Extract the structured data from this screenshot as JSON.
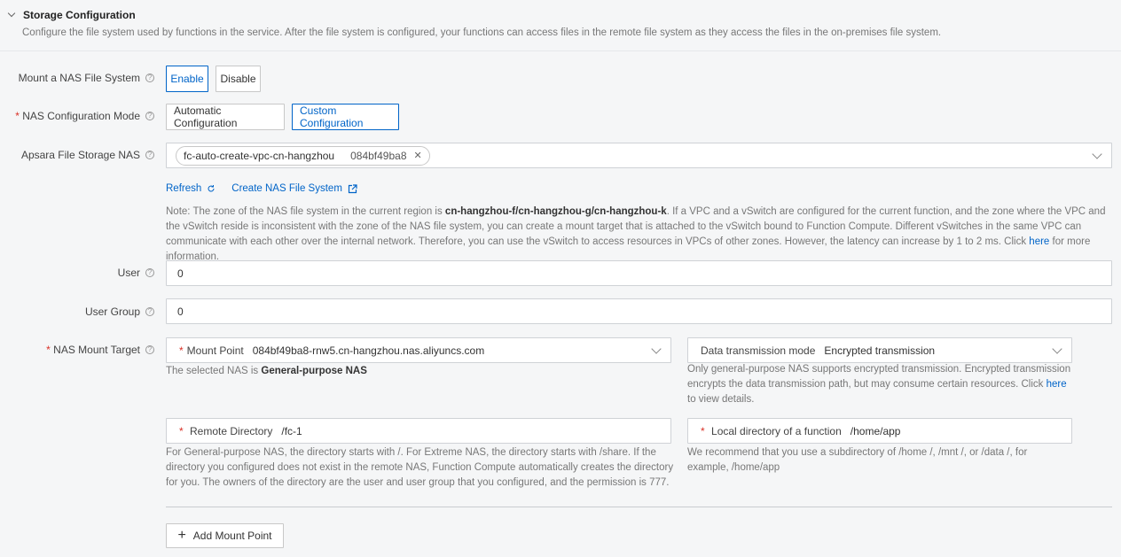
{
  "section": {
    "title": "Storage Configuration",
    "description": "Configure the file system used by functions in the service. After the file system is configured, your functions can access files in the remote file system as they access the files in the on-premises file system."
  },
  "mount_nas": {
    "label": "Mount a NAS File System",
    "options": [
      "Enable",
      "Disable"
    ],
    "selected": "Enable"
  },
  "config_mode": {
    "label": "NAS Configuration Mode",
    "required": "*",
    "options": [
      "Automatic Configuration",
      "Custom Configuration"
    ],
    "selected": "Custom Configuration"
  },
  "apsara_nas": {
    "label": "Apsara File Storage NAS",
    "tag_name": "fc-auto-create-vpc-cn-hangzhou",
    "tag_id": "084bf49ba8",
    "tag_close": "✕",
    "refresh_label": "Refresh",
    "create_label": "Create NAS File System",
    "note_prefix": "Note: The zone of the NAS file system in the current region is ",
    "note_zones": "cn-hangzhou-f/cn-hangzhou-g/cn-hangzhou-k",
    "note_body": ". If a VPC and a vSwitch are configured for the current function, and the zone where the VPC and the vSwitch reside is inconsistent with the zone of the NAS file system, you can create a mount target that is attached to the vSwitch bound to Function Compute. Different vSwitches in the same VPC can communicate with each other over the internal network. Therefore, you can use the vSwitch to access resources in VPCs of other zones. However, the latency can increase by 1 to 2 ms. Click ",
    "note_link": "here",
    "note_suffix": " for more information."
  },
  "user": {
    "label": "User",
    "value": "0"
  },
  "user_group": {
    "label": "User Group",
    "value": "0"
  },
  "mount_target": {
    "label": "NAS Mount Target",
    "required": "*",
    "mount_point_label": "Mount Point",
    "mount_point_value": "084bf49ba8-rnw5.cn-hangzhou.nas.aliyuncs.com",
    "selected_nas_prefix": "The selected NAS is ",
    "selected_nas_type": "General-purpose NAS",
    "transmission_label": "Data transmission mode",
    "transmission_value": "Encrypted transmission",
    "transmission_help_prefix": "Only general-purpose NAS supports encrypted transmission. Encrypted transmission encrypts the data transmission path, but may consume certain resources. Click ",
    "transmission_help_link": "here",
    "transmission_help_suffix": " to view details.",
    "remote_dir_label": "Remote Directory",
    "remote_dir_value": "/fc-1",
    "remote_dir_help": "For General-purpose NAS, the directory starts with /. For Extreme NAS, the directory starts with /share. If the directory you configured does not exist in the remote NAS, Function Compute automatically creates the directory for you. The owners of the directory are the user and user group that you configured, and the permission is 777.",
    "local_dir_label": "Local directory of a function",
    "local_dir_value": "/home/app",
    "local_dir_help": "We recommend that you use a subdirectory of /home /, /mnt /, or /data /, for example, /home/app"
  },
  "add_mount_point": {
    "icon": "+",
    "label": "Add Mount Point"
  },
  "help_glyph": "?",
  "colors": {
    "accent": "#0064c8",
    "required": "#d93026"
  }
}
